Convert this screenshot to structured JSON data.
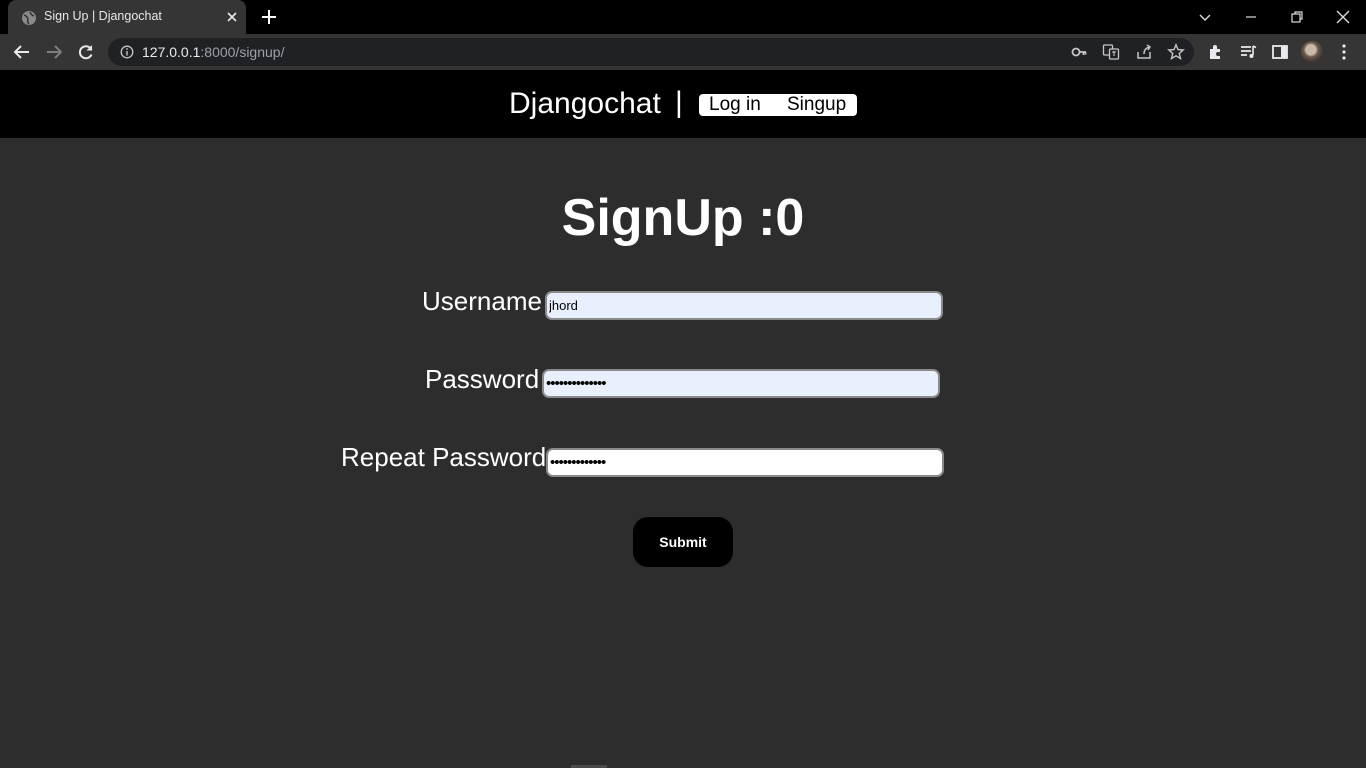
{
  "browser": {
    "tab_title": "Sign Up | Djangochat",
    "url_host": "127.0.0.1",
    "url_rest": ":8000/signup/"
  },
  "site": {
    "brand": "Djangochat",
    "separator": "|",
    "nav": {
      "login": "Log in",
      "signup": "Singup"
    }
  },
  "form": {
    "heading": "SignUp :0",
    "username_label": "Username",
    "username_value": "jhord",
    "password_label": "Password",
    "password_value": "••••••••••••••",
    "repeat_label": "Repeat Password",
    "repeat_value": "•••••••••••••",
    "submit_label": "Submit"
  }
}
